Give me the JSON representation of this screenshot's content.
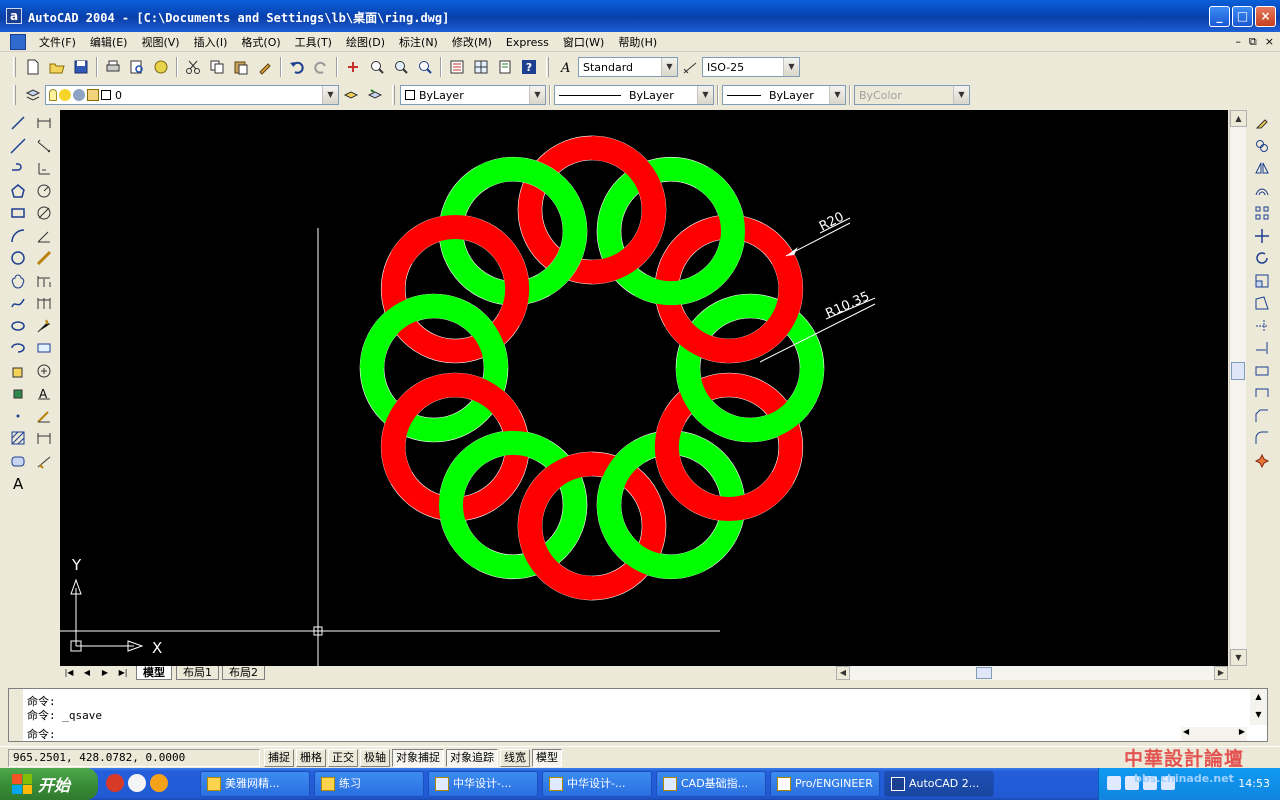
{
  "window": {
    "title": "AutoCAD 2004 - [C:\\Documents and Settings\\lb\\桌面\\ring.dwg]",
    "app_glyph": "a",
    "controls": [
      "_",
      "□",
      "×"
    ]
  },
  "menu": {
    "items": [
      "文件(F)",
      "编辑(E)",
      "视图(V)",
      "插入(I)",
      "格式(O)",
      "工具(T)",
      "绘图(D)",
      "标注(N)",
      "修改(M)",
      "Express",
      "窗口(W)",
      "帮助(H)"
    ],
    "mdi_controls": [
      "–",
      "⧉",
      "×"
    ]
  },
  "toolbar": {
    "text_style": "Standard",
    "dim_style": "ISO-25"
  },
  "properties": {
    "layer": "0",
    "color": "ByLayer",
    "linetype": "ByLayer",
    "lineweight": "ByLayer",
    "plotstyle": "ByColor"
  },
  "drawing": {
    "colors": {
      "red": "#ff0000",
      "green": "#00ff00",
      "background": "#000000"
    },
    "ring_count": 12,
    "annotations": [
      {
        "label": "R20"
      },
      {
        "label": "R10.35"
      }
    ],
    "ucs": {
      "x_label": "X",
      "y_label": "Y"
    }
  },
  "tabs": {
    "nav": [
      "|◀",
      "◀",
      "▶",
      "▶|"
    ],
    "items": [
      {
        "label": "模型",
        "active": true
      },
      {
        "label": "布局1",
        "active": false
      },
      {
        "label": "布局2",
        "active": false
      }
    ]
  },
  "command": {
    "lines": [
      "命令:",
      "命令: _qsave",
      "命令:"
    ]
  },
  "status": {
    "coords": "965.2501,  428.0782,  0.0000",
    "buttons": [
      {
        "label": "捕捉",
        "on": false
      },
      {
        "label": "栅格",
        "on": false
      },
      {
        "label": "正交",
        "on": false
      },
      {
        "label": "极轴",
        "on": false
      },
      {
        "label": "对象捕捉",
        "on": true
      },
      {
        "label": "对象追踪",
        "on": true
      },
      {
        "label": "线宽",
        "on": false
      },
      {
        "label": "模型",
        "on": true
      }
    ]
  },
  "taskbar": {
    "start_label": "开始",
    "tasks": [
      {
        "label": "美雅网精...",
        "active": false
      },
      {
        "label": "练习",
        "active": false
      },
      {
        "label": "中华设计-...",
        "active": false
      },
      {
        "label": "中华设计-...",
        "active": false
      },
      {
        "label": "CAD基础指...",
        "active": false
      },
      {
        "label": "Pro/ENGINEER",
        "active": false
      },
      {
        "label": "AutoCAD 2...",
        "active": true
      }
    ],
    "clock": "14:53"
  },
  "watermark": {
    "text": "中華設計論壇",
    "url": "bbs.chinade.net"
  }
}
